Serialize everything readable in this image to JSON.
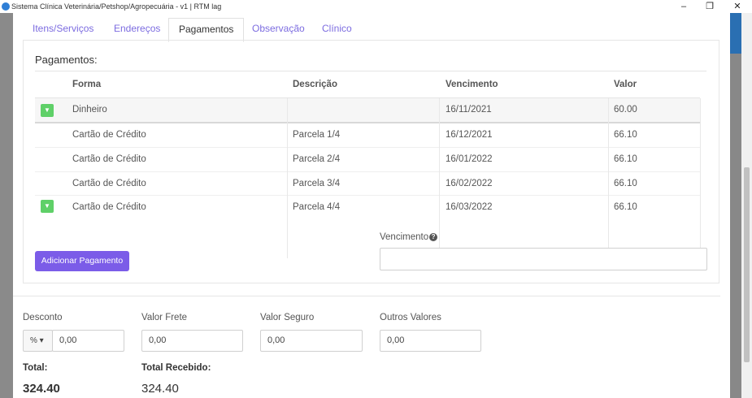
{
  "window": {
    "title": "Sistema Clínica Veterinária/Petshop/Agropecuária - v1 | RTM lag",
    "minimize": "‒",
    "maximize": "❐",
    "close": "✕"
  },
  "tabs": [
    {
      "label": "Itens/Serviços"
    },
    {
      "label": "Endereços"
    },
    {
      "label": "Pagamentos",
      "active": true
    },
    {
      "label": "Observação"
    },
    {
      "label": "Clínico"
    }
  ],
  "pagamentos": {
    "title": "Pagamentos:",
    "columns": {
      "forma": "Forma",
      "descricao": "Descrição",
      "vencimento": "Vencimento",
      "valor": "Valor"
    },
    "rows": [
      {
        "forma": "Dinheiro",
        "descricao": "",
        "vencimento": "16/11/2021",
        "valor": "60.00"
      },
      {
        "forma": "Cartão de Crédito",
        "descricao": "Parcela 1/4",
        "vencimento": "16/12/2021",
        "valor": "66.10"
      },
      {
        "forma": "Cartão de Crédito",
        "descricao": "Parcela 2/4",
        "vencimento": "16/01/2022",
        "valor": "66.10"
      },
      {
        "forma": "Cartão de Crédito",
        "descricao": "Parcela 3/4",
        "vencimento": "16/02/2022",
        "valor": "66.10"
      },
      {
        "forma": "Cartão de Crédito",
        "descricao": "Parcela 4/4",
        "vencimento": "16/03/2022",
        "valor": "66.10"
      }
    ],
    "add_button": "Adicionar Pagamento",
    "vencimento_label": "Vencimento",
    "vencimento_value": ""
  },
  "footer": {
    "desconto_label": "Desconto",
    "desconto_type": "% ▾",
    "desconto_value": "0,00",
    "frete_label": "Valor Frete",
    "frete_value": "0,00",
    "seguro_label": "Valor Seguro",
    "seguro_value": "0,00",
    "outros_label": "Outros Valores",
    "outros_value": "0,00",
    "total_label": "Total:",
    "total_value": "324.40",
    "recebido_label": "Total Recebido:",
    "recebido_value": "324.40"
  },
  "colors": {
    "accent": "#7b5ce8",
    "toggle": "#5fd068",
    "tab_link": "#7c6ce0"
  }
}
